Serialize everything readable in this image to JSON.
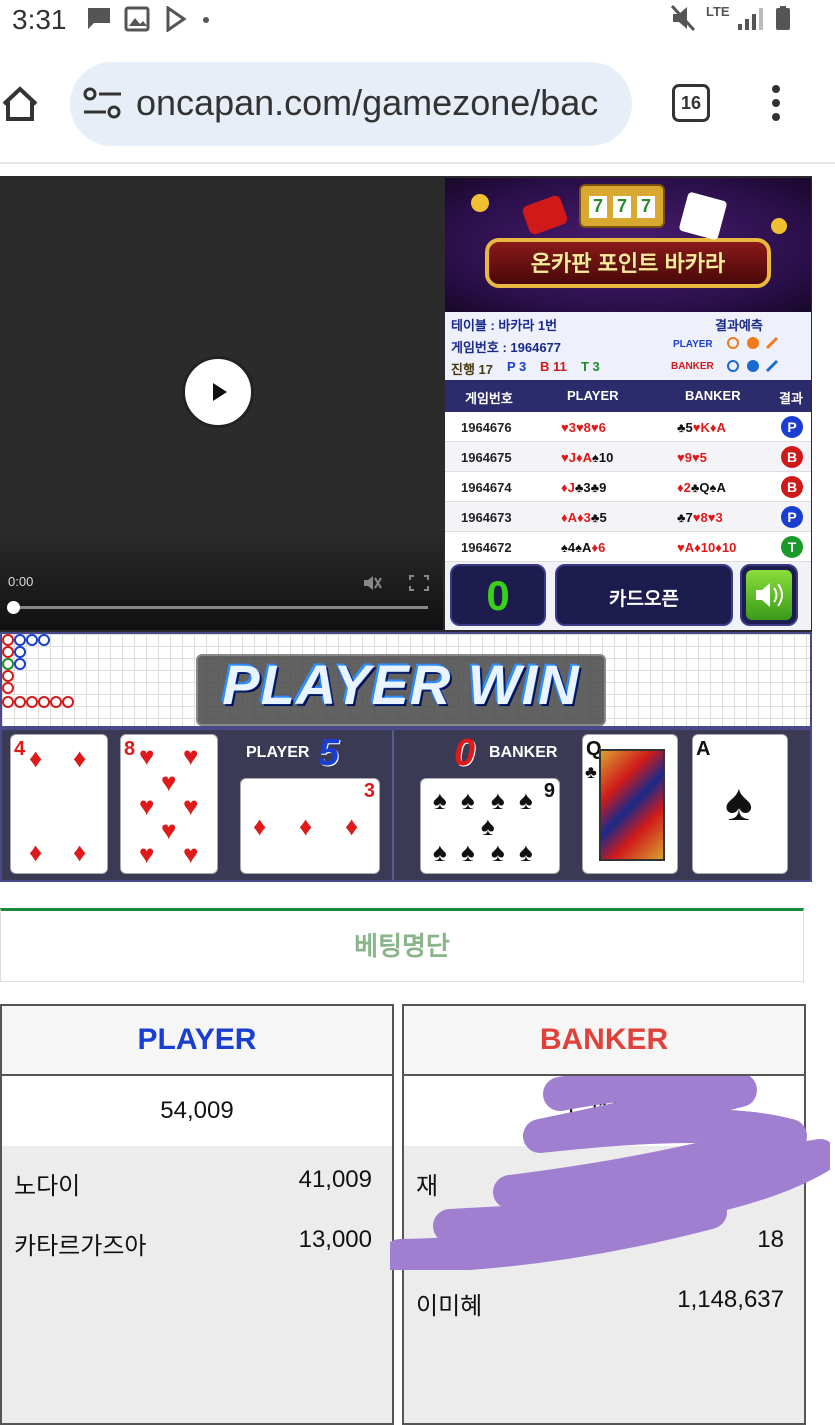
{
  "status_bar": {
    "time": "3:31",
    "network": "LTE"
  },
  "browser": {
    "url": "oncapan.com/gamezone/bac",
    "tab_count": "16"
  },
  "video": {
    "time": "0:00"
  },
  "banner": {
    "title": "온카판 포인트 바카라",
    "slot": [
      "7",
      "7",
      "7"
    ]
  },
  "table_info": {
    "table": "테이블 : 바카라 1번",
    "game_no": "게임번호 : 1964677",
    "progress_label": "진행 17",
    "p_count": "P 3",
    "b_count": "B 11",
    "t_count": "T 3",
    "prediction_label": "결과예측",
    "player_label": "PLAYER",
    "banker_label": "BANKER"
  },
  "history": {
    "headers": [
      "게임번호",
      "PLAYER",
      "BANKER",
      "결과"
    ],
    "rows": [
      {
        "no": "1964676",
        "player": [
          [
            "♥",
            "3"
          ],
          [
            "♥",
            "8"
          ],
          [
            "♥",
            "6"
          ]
        ],
        "banker": [
          [
            "♣",
            "5"
          ],
          [
            "♥",
            "K"
          ],
          [
            "♦",
            "A"
          ]
        ],
        "result": "P",
        "color": "#1a3fd0"
      },
      {
        "no": "1964675",
        "player": [
          [
            "♥",
            "J"
          ],
          [
            "♦",
            "A"
          ],
          [
            "♠",
            "10"
          ]
        ],
        "banker": [
          [
            "♥",
            "9"
          ],
          [
            "♥",
            "5"
          ]
        ],
        "result": "B",
        "color": "#d01a1a"
      },
      {
        "no": "1964674",
        "player": [
          [
            "♦",
            "J"
          ],
          [
            "♣",
            "3"
          ],
          [
            "♣",
            "9"
          ]
        ],
        "banker": [
          [
            "♦",
            "2"
          ],
          [
            "♣",
            "Q"
          ],
          [
            "♠",
            "A"
          ]
        ],
        "result": "B",
        "color": "#d01a1a"
      },
      {
        "no": "1964673",
        "player": [
          [
            "♦",
            "A"
          ],
          [
            "♦",
            "3"
          ],
          [
            "♣",
            "5"
          ]
        ],
        "banker": [
          [
            "♣",
            "7"
          ],
          [
            "♥",
            "8"
          ],
          [
            "♥",
            "3"
          ]
        ],
        "result": "P",
        "color": "#1a3fd0"
      },
      {
        "no": "1964672",
        "player": [
          [
            "♠",
            "4"
          ],
          [
            "♠",
            "A"
          ],
          [
            "♦",
            "6"
          ]
        ],
        "banker": [
          [
            "♥",
            "A"
          ],
          [
            "♦",
            "10"
          ],
          [
            "♦",
            "10"
          ]
        ],
        "result": "T",
        "color": "#1a9a2a"
      }
    ]
  },
  "controls": {
    "counter": "0",
    "open_button": "카드오픈"
  },
  "result_banner": "PLAYER WIN",
  "player_hand": {
    "label": "PLAYER",
    "score": "5"
  },
  "banker_hand": {
    "label": "BANKER",
    "score": "0"
  },
  "cards": [
    {
      "rank": "4",
      "suit": "♦",
      "color": "red"
    },
    {
      "rank": "8",
      "suit": "♥",
      "color": "red"
    },
    {
      "rank": "3",
      "suit": "♦",
      "color": "red"
    },
    {
      "rank": "9",
      "suit": "♠",
      "color": "black"
    },
    {
      "rank": "Q",
      "suit": "♣",
      "color": "black"
    },
    {
      "rank": "A",
      "suit": "♠",
      "color": "black"
    }
  ],
  "betting": {
    "title": "베팅명단",
    "player": {
      "header": "PLAYER",
      "total": "54,009",
      "rows": [
        {
          "name": "노다이",
          "amount": "41,009"
        },
        {
          "name": "카타르가즈아",
          "amount": "13,000"
        }
      ]
    },
    "banker": {
      "header": "BANKER",
      "total": "1,216,2",
      "rows": [
        {
          "name": "재",
          "amount": ""
        },
        {
          "name": "",
          "amount": "18"
        },
        {
          "name": "이미혜",
          "amount": "1,148,637"
        }
      ]
    }
  },
  "colors": {
    "player_blue": "#1a3fd0",
    "banker_red": "#e0413a",
    "green": "#1a8a3a",
    "scribble": "#a07fd0"
  }
}
